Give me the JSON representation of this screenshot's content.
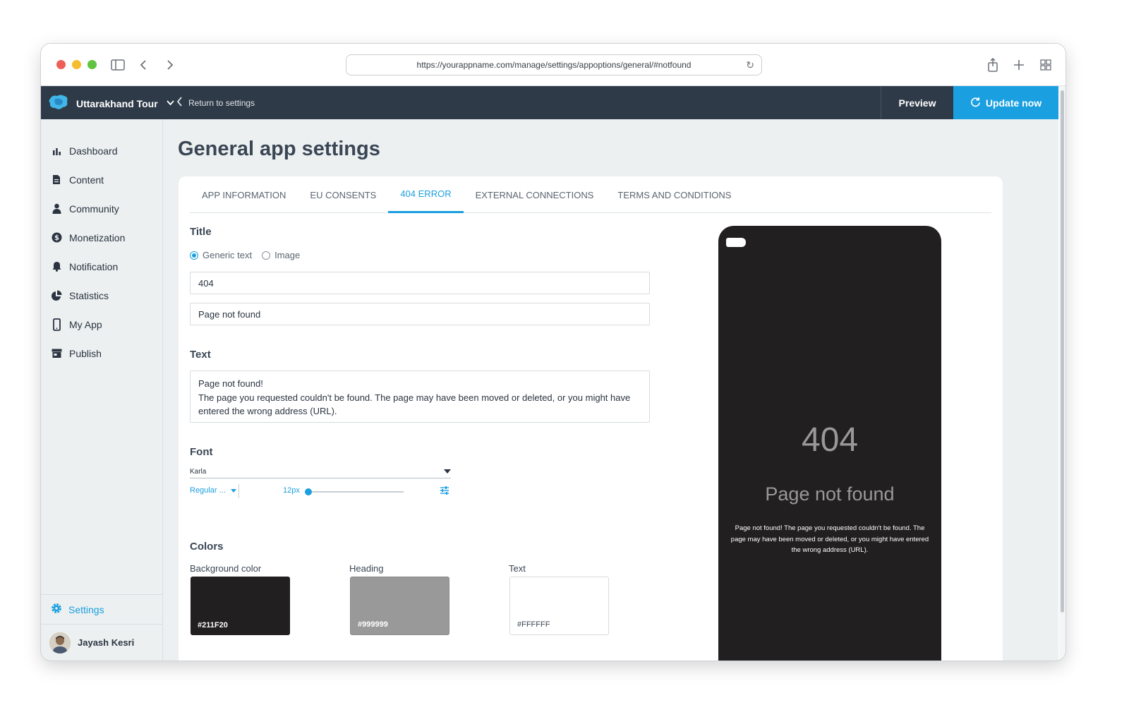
{
  "browser": {
    "url": "https://yourappname.com/manage/settings/appoptions/general/#notfound"
  },
  "topbar": {
    "app_name": "Uttarakhand Tour",
    "return_label": "Return to settings",
    "preview_label": "Preview",
    "update_label": "Update now"
  },
  "sidebar": {
    "items": [
      {
        "label": "Dashboard",
        "icon": "bar-chart-icon"
      },
      {
        "label": "Content",
        "icon": "document-icon"
      },
      {
        "label": "Community",
        "icon": "person-icon"
      },
      {
        "label": "Monetization",
        "icon": "dollar-icon"
      },
      {
        "label": "Notification",
        "icon": "bell-icon"
      },
      {
        "label": "Statistics",
        "icon": "pie-chart-icon"
      },
      {
        "label": "My App",
        "icon": "phone-icon"
      },
      {
        "label": "Publish",
        "icon": "store-icon"
      }
    ],
    "settings_label": "Settings",
    "user_name": "Jayash Kesri"
  },
  "main": {
    "page_title": "General app settings",
    "tabs": [
      {
        "label": "APP INFORMATION"
      },
      {
        "label": "EU CONSENTS"
      },
      {
        "label": "404 ERROR"
      },
      {
        "label": "EXTERNAL CONNECTIONS"
      },
      {
        "label": "TERMS AND CONDITIONS"
      }
    ],
    "active_tab": "404 ERROR",
    "title_section": {
      "heading": "Title",
      "option_generic": "Generic text",
      "option_image": "Image",
      "selected": "Generic text",
      "title_value": "404",
      "subtitle_value": "Page not found"
    },
    "text_section": {
      "heading": "Text",
      "line1": "Page not found!",
      "line2": "The page you requested couldn't be found. The page may have been moved or deleted, or you might have entered the wrong address (URL)."
    },
    "font_section": {
      "heading": "Font",
      "family": "Karla",
      "weight": "Regular ...",
      "size": "12px",
      "size_level": 0.0
    },
    "colors_section": {
      "heading": "Colors",
      "background_label": "Background color",
      "background_value": "#211F20",
      "heading_label": "Heading",
      "heading_value": "#999999",
      "text_label": "Text",
      "text_value": "#FFFFFF"
    }
  },
  "preview": {
    "big_title": "404",
    "subtitle": "Page not found",
    "body": "Page not found! The page you requested couldn't be found. The page may have been moved or deleted, or you might have entered the wrong address (URL)."
  },
  "colors": {
    "accent": "#1a9fe0",
    "topbar": "#2f3a48",
    "sidebar": "#ecf0f1"
  }
}
